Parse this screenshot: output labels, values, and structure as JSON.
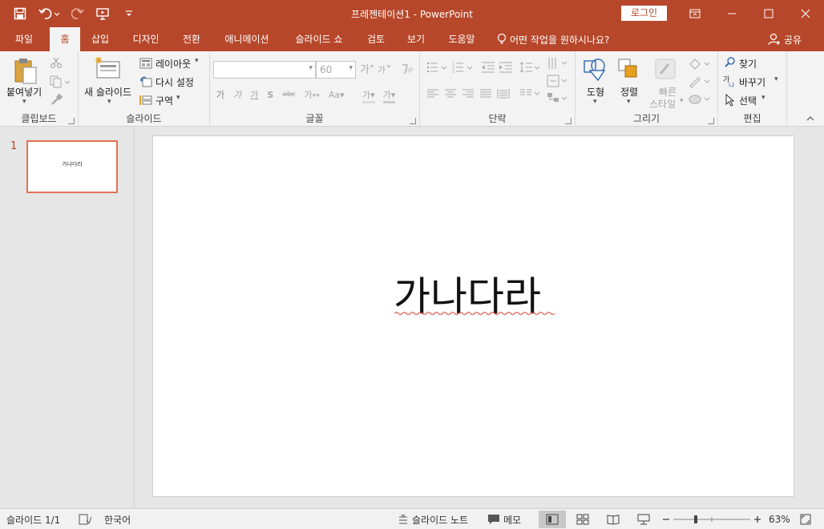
{
  "app": {
    "window_title": "프레젠테이션1  -  PowerPoint",
    "login_label": "로그인"
  },
  "tabs": [
    {
      "label": "파일"
    },
    {
      "label": "홈"
    },
    {
      "label": "삽입"
    },
    {
      "label": "디자인"
    },
    {
      "label": "전환"
    },
    {
      "label": "애니메이션"
    },
    {
      "label": "슬라이드 쇼"
    },
    {
      "label": "검토"
    },
    {
      "label": "보기"
    },
    {
      "label": "도움말"
    }
  ],
  "tell_me": "어떤 작업을 원하시나요?",
  "share_label": "공유",
  "ribbon": {
    "clipboard": {
      "label": "클립보드",
      "paste": "붙여넣기"
    },
    "slides": {
      "label": "슬라이드",
      "new_slide": "새 슬라이드",
      "layout": "레이아웃",
      "reset": "다시 설정",
      "section": "구역"
    },
    "font": {
      "label": "글꼴",
      "font_name": "",
      "font_size": "60"
    },
    "paragraph": {
      "label": "단락"
    },
    "drawing": {
      "label": "그리기",
      "shapes": "도형",
      "arrange": "정렬",
      "quick_styles_1": "빠른",
      "quick_styles_2": "스타일"
    },
    "editing": {
      "label": "편집",
      "find": "찾기",
      "replace": "바꾸기",
      "select": "선택"
    }
  },
  "slides": [
    {
      "number": "1",
      "text": "가나다라"
    }
  ],
  "current_slide": {
    "title": "가나다라"
  },
  "status": {
    "slide_counter": "슬라이드 1/1",
    "language": "한국어",
    "notes": "슬라이드 노트",
    "comments": "메모",
    "zoom": "63%"
  },
  "colors": {
    "accent": "#b7472a",
    "thumb_border": "#e27254"
  }
}
